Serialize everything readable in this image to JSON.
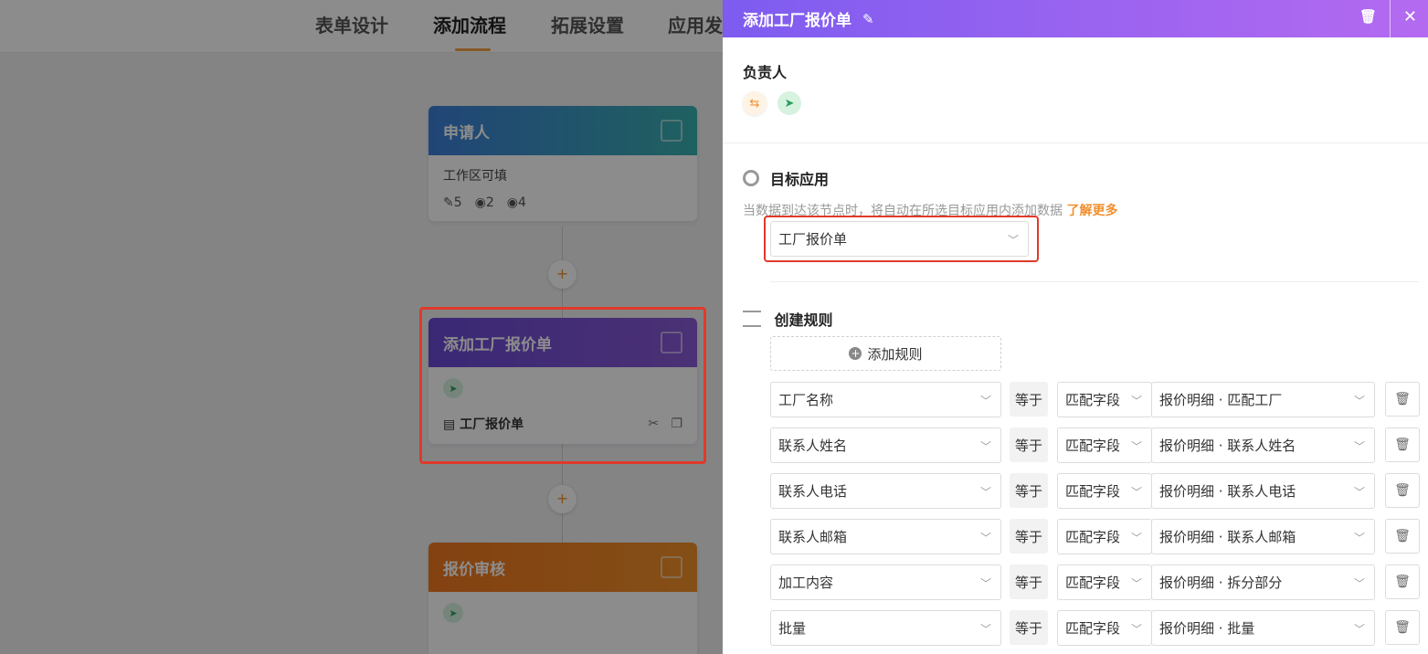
{
  "top_tabs": [
    "表单设计",
    "添加流程",
    "拓展设置",
    "应用发"
  ],
  "flow": {
    "applicant": {
      "title": "申请人",
      "subtitle": "工作区可填",
      "stat_edit": "5",
      "stat_view": "2",
      "stat_hidden": "4"
    },
    "add_node": {
      "title": "添加工厂报价单",
      "form_name": "工厂报价单"
    },
    "review": {
      "title": "报价审核"
    },
    "add_symbol": "+"
  },
  "panel": {
    "title": "添加工厂报价单",
    "owner_label": "负责人",
    "target_label": "目标应用",
    "target_desc": "当数据到达该节点时，将自动在所选目标应用内添加数据",
    "learn_more": "了解更多",
    "target_value": "工厂报价单",
    "rules_label": "创建规则",
    "add_rule": "添加规则",
    "rules": [
      {
        "field": "工厂名称",
        "op": "等于",
        "mode": "匹配字段",
        "target": "报价明细 · 匹配工厂"
      },
      {
        "field": "联系人姓名",
        "op": "等于",
        "mode": "匹配字段",
        "target": "报价明细 · 联系人姓名"
      },
      {
        "field": "联系人电话",
        "op": "等于",
        "mode": "匹配字段",
        "target": "报价明细 · 联系人电话"
      },
      {
        "field": "联系人邮箱",
        "op": "等于",
        "mode": "匹配字段",
        "target": "报价明细 · 联系人邮箱"
      },
      {
        "field": "加工内容",
        "op": "等于",
        "mode": "匹配字段",
        "target": "报价明细 · 拆分部分"
      },
      {
        "field": "批量",
        "op": "等于",
        "mode": "匹配字段",
        "target": "报价明细 · 批量"
      }
    ]
  },
  "colors": {
    "accent": "#f09030",
    "highlight": "#e03a2a",
    "header_purple": "#7d5cf0"
  }
}
